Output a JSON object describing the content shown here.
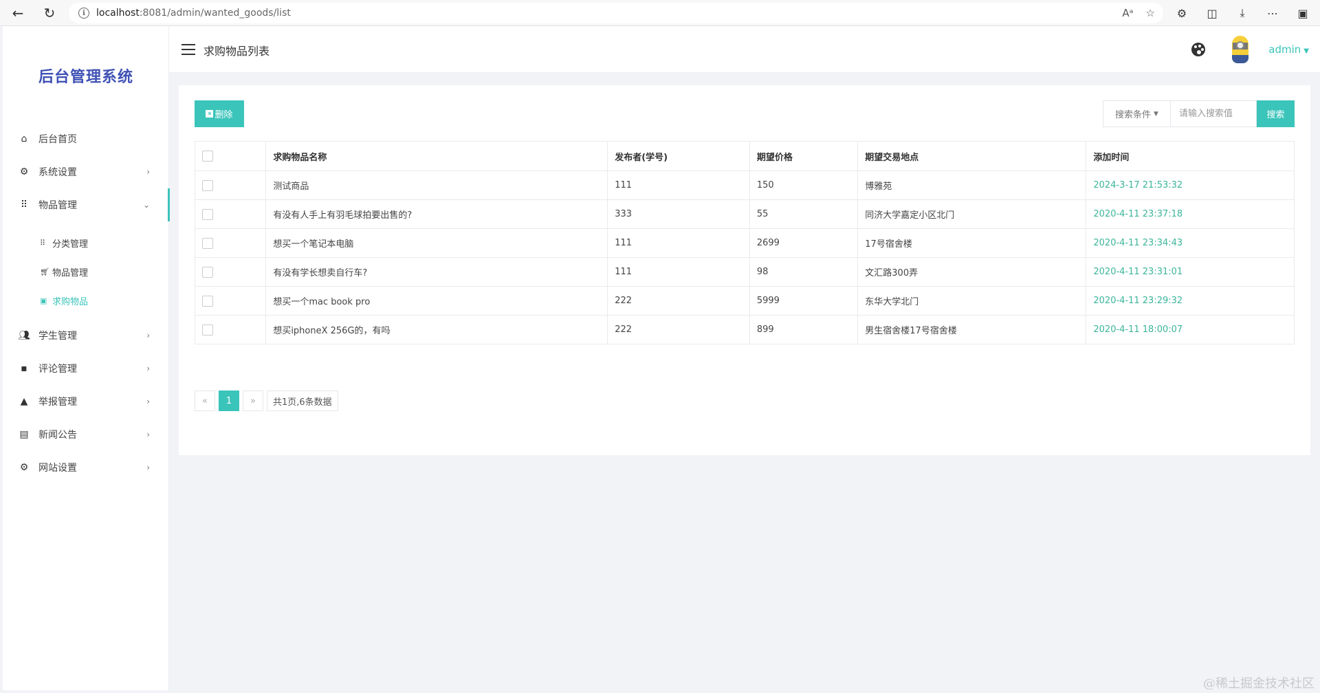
{
  "browser": {
    "url_host": "localhost",
    "url_rest": ":8081/admin/wanted_goods/list"
  },
  "sidebar": {
    "brand": "后台管理系统",
    "items": [
      {
        "label": "后台首页",
        "icon": "home-icon"
      },
      {
        "label": "系统设置",
        "icon": "gear-icon"
      },
      {
        "label": "物品管理",
        "icon": "grid-icon"
      },
      {
        "label": "学生管理",
        "icon": "users-icon"
      },
      {
        "label": "评论管理",
        "icon": "comment-icon"
      },
      {
        "label": "举报管理",
        "icon": "warning-icon"
      },
      {
        "label": "新闻公告",
        "icon": "news-icon"
      },
      {
        "label": "网站设置",
        "icon": "gear-icon"
      }
    ],
    "submenu": [
      {
        "label": "分类管理",
        "icon": "grid-icon"
      },
      {
        "label": "物品管理",
        "icon": "cart-icon"
      },
      {
        "label": "求购物品",
        "icon": "money-icon"
      }
    ]
  },
  "header": {
    "title": "求购物品列表",
    "user": "admin"
  },
  "toolbar": {
    "delete_label": "删除",
    "search_condition": "搜索条件",
    "search_placeholder": "请输入搜索值",
    "search_label": "搜索"
  },
  "table": {
    "columns": [
      "求购物品名称",
      "发布者(学号)",
      "期望价格",
      "期望交易地点",
      "添加时间"
    ],
    "rows": [
      {
        "name": "测试商品",
        "publisher": "111",
        "price": "150",
        "place": "博雅苑",
        "time": "2024-3-17 21:53:32"
      },
      {
        "name": "有没有人手上有羽毛球拍要出售的?",
        "publisher": "333",
        "price": "55",
        "place": "同济大学嘉定小区北门",
        "time": "2020-4-11 23:37:18"
      },
      {
        "name": "想买一个笔记本电脑",
        "publisher": "111",
        "price": "2699",
        "place": "17号宿舍楼",
        "time": "2020-4-11 23:34:43"
      },
      {
        "name": "有没有学长想卖自行车?",
        "publisher": "111",
        "price": "98",
        "place": "文汇路300弄",
        "time": "2020-4-11 23:31:01"
      },
      {
        "name": "想买一个mac book pro",
        "publisher": "222",
        "price": "5999",
        "place": "东华大学北门",
        "time": "2020-4-11 23:29:32"
      },
      {
        "name": "想买iphoneX 256G的，有吗",
        "publisher": "222",
        "price": "899",
        "place": "男生宿舍楼17号宿舍楼",
        "time": "2020-4-11 18:00:07"
      }
    ]
  },
  "pager": {
    "prev": "«",
    "current": "1",
    "next": "»",
    "info": "共1页,6条数据"
  },
  "watermark": "@稀土掘金技术社区",
  "colors": {
    "accent": "#3bc4ba",
    "brand": "#3f51b5",
    "time_text": "#3bb59a"
  }
}
